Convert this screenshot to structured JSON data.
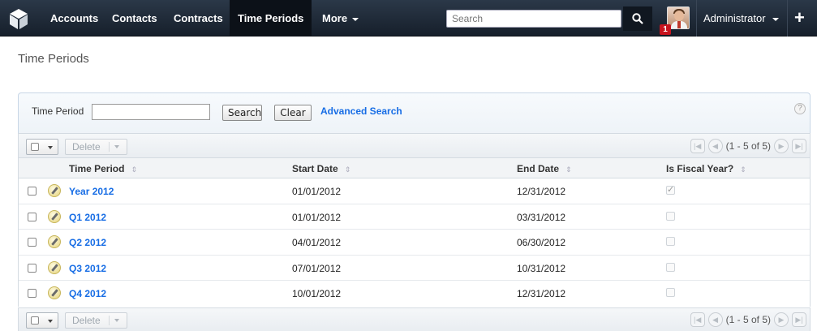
{
  "nav": {
    "items": [
      "Accounts",
      "Contacts",
      "Contracts",
      "Time Periods",
      "More"
    ],
    "active": "Time Periods",
    "search_placeholder": "Search",
    "notification_count": "1",
    "user": "Administrator"
  },
  "page": {
    "title": "Time Periods"
  },
  "search_panel": {
    "label": "Time Period",
    "input_value": "",
    "search_label": "Search",
    "clear_label": "Clear",
    "advanced_label": "Advanced Search"
  },
  "toolbar": {
    "delete_label": "Delete",
    "page_range": "(1 - 5 of 5)"
  },
  "table": {
    "columns": [
      "Time Period",
      "Start Date",
      "End Date",
      "Is Fiscal Year?"
    ],
    "rows": [
      {
        "name": "Year 2012",
        "start": "01/01/2012",
        "end": "12/31/2012",
        "fiscal": true
      },
      {
        "name": "Q1 2012",
        "start": "01/01/2012",
        "end": "03/31/2012",
        "fiscal": false
      },
      {
        "name": "Q2 2012",
        "start": "04/01/2012",
        "end": "06/30/2012",
        "fiscal": false
      },
      {
        "name": "Q3 2012",
        "start": "07/01/2012",
        "end": "10/31/2012",
        "fiscal": false
      },
      {
        "name": "Q4 2012",
        "start": "10/01/2012",
        "end": "12/31/2012",
        "fiscal": false
      }
    ]
  },
  "colors": {
    "nav_bg": "#1f2a3a",
    "link": "#176de5",
    "badge": "#c8141e"
  }
}
